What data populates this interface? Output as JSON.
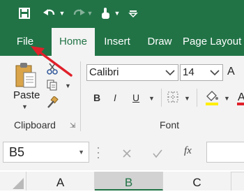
{
  "colors": {
    "brand": "#217346",
    "arrow": "#e0202a",
    "selected_header": "#d2d2d2",
    "selected_text": "#217346"
  },
  "tabs": [
    {
      "label": "File"
    },
    {
      "label": "Home"
    },
    {
      "label": "Insert"
    },
    {
      "label": "Draw"
    },
    {
      "label": "Page Layout"
    }
  ],
  "ribbon": {
    "clipboard": {
      "paste_label": "Paste",
      "group_label": "Clipboard"
    },
    "font": {
      "font_name": "Calibri",
      "font_size": "14",
      "group_label": "Font",
      "bold": "B",
      "italic": "I",
      "underline": "U"
    }
  },
  "formula_bar": {
    "name_box": "B5",
    "fx": "fx"
  },
  "columns": [
    "A",
    "B",
    "C"
  ],
  "selected_column": "B"
}
